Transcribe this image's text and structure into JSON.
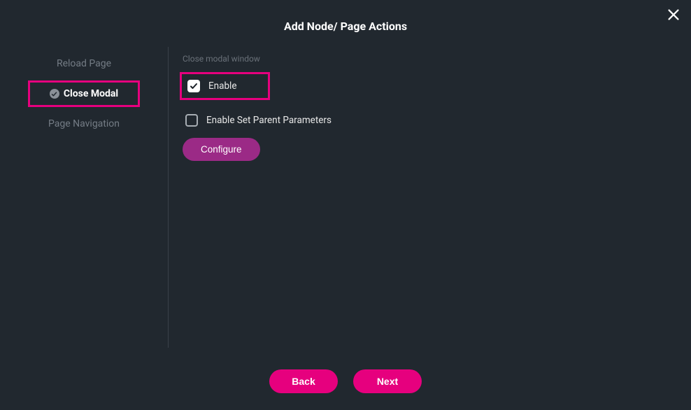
{
  "title": "Add Node/ Page Actions",
  "sidebar": {
    "items": [
      {
        "label": "Reload Page"
      },
      {
        "label": "Close Modal"
      },
      {
        "label": "Page Navigation"
      }
    ]
  },
  "main": {
    "section_label": "Close modal window",
    "enable_label": "Enable",
    "set_parent_label": "Enable Set Parent Parameters",
    "configure_label": "Configure"
  },
  "footer": {
    "back_label": "Back",
    "next_label": "Next"
  }
}
